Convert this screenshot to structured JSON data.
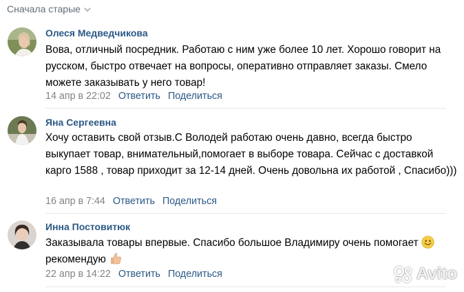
{
  "sort_label": "Сначала старые",
  "comments": [
    {
      "author": "Олеся Медведчикова",
      "text": "Вова, отличный посредник. Работаю с ним уже более 10 лет. Хорошо говорит на русском, быстро отвечает на вопросы, оперативно отправляет заказы. Смело можете заказывать у него товар!",
      "date": "14 апр в 22:02",
      "reply": "Ответить",
      "share": "Поделиться"
    },
    {
      "author": "Яна Сергеевна",
      "text": "Хочу оставить свой отзыв.С Володей работаю очень давно, всегда быстро выкупает товар, внимательный,помогает в выборе товара. Сейчас с доставкой карго 1588 , товар приходит за 12-14 дней. Очень довольна их работой , Спасибо)))",
      "date": "16 апр в 7:44",
      "reply": "Ответить",
      "share": "Поделиться"
    },
    {
      "author": "Инна Постовитюк",
      "text_part1": "Заказывала товары впервые. Спасибо большое Владимиру очень помогает",
      "text_part2": "рекомендую",
      "date": "22 апр в 14:22",
      "reply": "Ответить",
      "share": "Поделиться"
    }
  ],
  "watermark": "Avito",
  "colors": {
    "link": "#2a5885",
    "meta": "#828282",
    "separator": "#e7e8ec"
  }
}
